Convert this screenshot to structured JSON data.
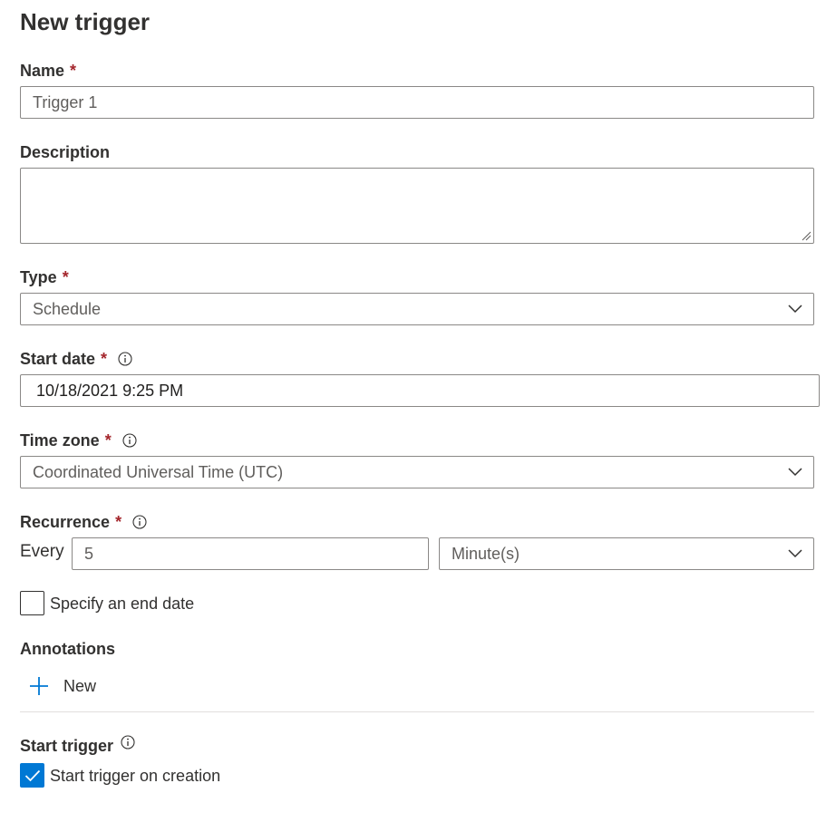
{
  "panel": {
    "title": "New trigger"
  },
  "name": {
    "label": "Name",
    "required_mark": "*",
    "value": "Trigger 1"
  },
  "description": {
    "label": "Description",
    "value": ""
  },
  "type": {
    "label": "Type",
    "required_mark": "*",
    "value": "Schedule"
  },
  "start_date": {
    "label": "Start date",
    "required_mark": "*",
    "value": "10/18/2021 9:25 PM"
  },
  "time_zone": {
    "label": "Time zone",
    "required_mark": "*",
    "value": "Coordinated Universal Time (UTC)"
  },
  "recurrence": {
    "label": "Recurrence",
    "required_mark": "*",
    "every_label": "Every",
    "interval_value": "5",
    "unit_value": "Minute(s)"
  },
  "end_date": {
    "label": "Specify an end date",
    "checked": false
  },
  "annotations": {
    "label": "Annotations",
    "new_label": "New"
  },
  "start_trigger": {
    "label": "Start trigger",
    "checkbox_label": "Start trigger on creation",
    "checked": true
  },
  "colors": {
    "accent": "#0078d4",
    "required": "#a4262c",
    "border": "#8a8886",
    "text": "#323130"
  },
  "icons": {
    "info": "info-icon",
    "chevron": "chevron-down-icon",
    "add": "add-icon",
    "check": "checkmark-icon",
    "resize": "resize-grip-icon"
  }
}
